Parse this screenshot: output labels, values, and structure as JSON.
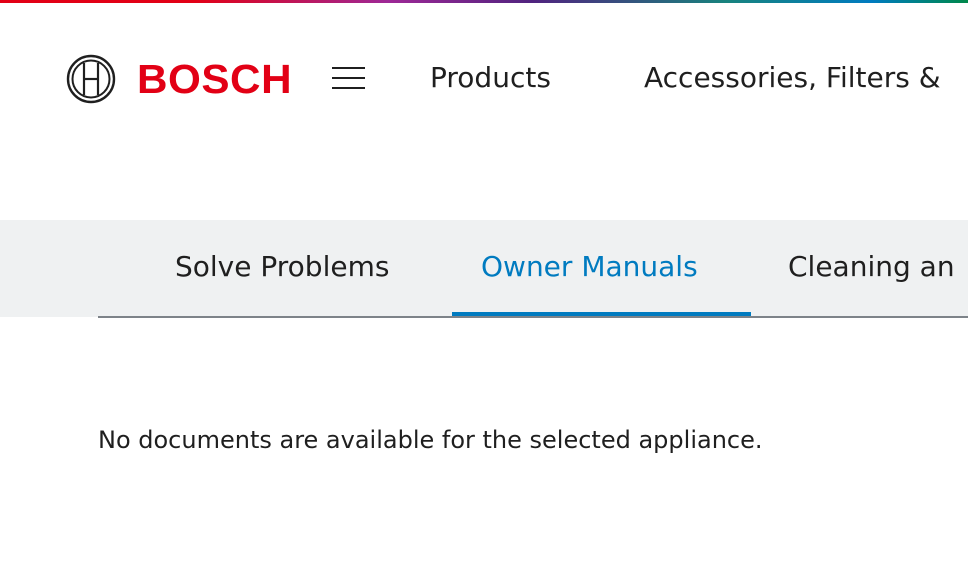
{
  "brand": {
    "name": "BOSCH",
    "color": "#e20015"
  },
  "header": {
    "menu_icon": "hamburger-menu-icon",
    "nav": [
      {
        "label": "Products"
      },
      {
        "label": "Accessories, Filters &"
      }
    ]
  },
  "tabs": [
    {
      "label": "Solve Problems",
      "active": false
    },
    {
      "label": "Owner Manuals",
      "active": true
    },
    {
      "label": "Cleaning an",
      "active": false
    }
  ],
  "colors": {
    "accent": "#007bc0",
    "tab_bar_bg": "#eff1f2",
    "text": "#1f1f1f"
  },
  "content": {
    "message": "No documents are available for the selected appliance."
  }
}
